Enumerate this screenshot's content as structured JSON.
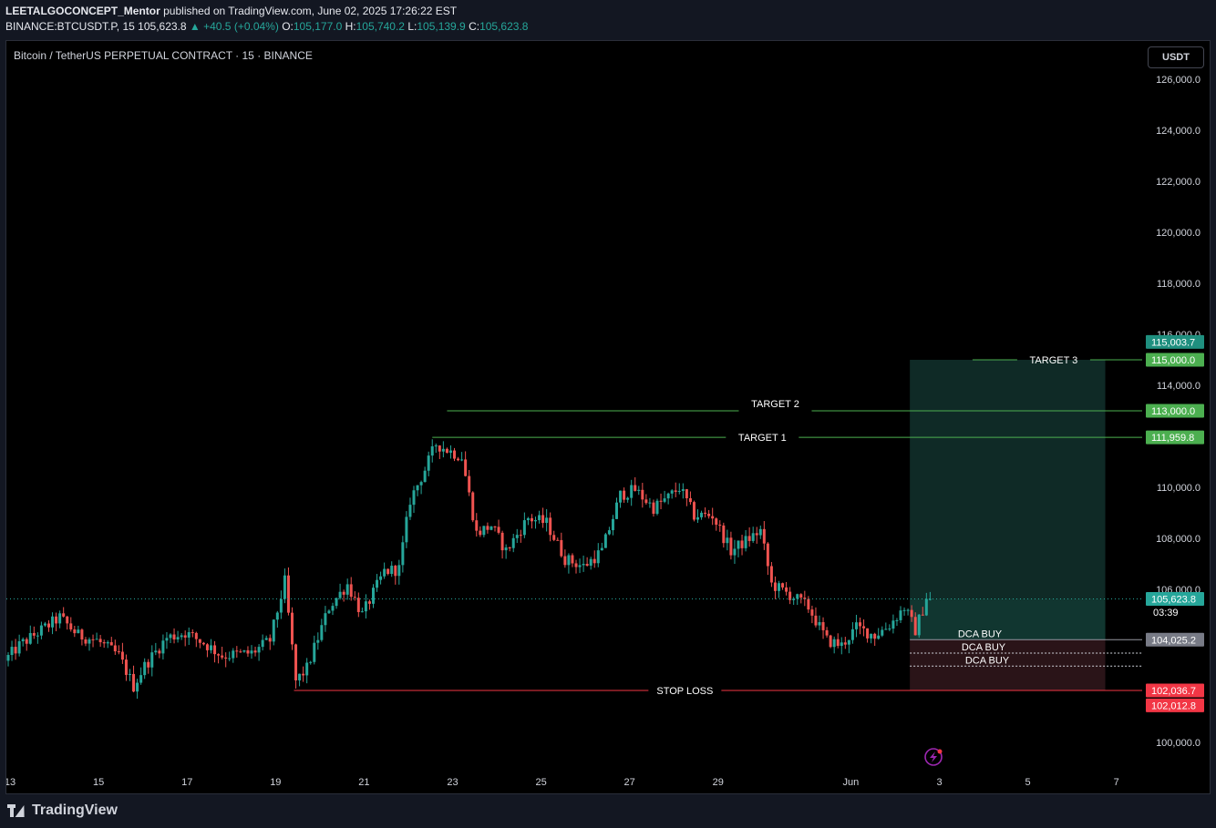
{
  "header": {
    "publisher": "LEETALGOCONCEPT_Mentor",
    "published_text": "published on TradingView.com, June 02, 2025 17:26:22 EST",
    "symbol": "BINANCE:BTCUSDT.P, 15",
    "price": "105,623.8",
    "change": "▲ +40.5 (+0.04%)",
    "o_label": "O:",
    "o_value": "105,177.0",
    "h_label": "H:",
    "h_value": "105,740.2",
    "l_label": "L:",
    "l_value": "105,139.9",
    "c_label": "C:",
    "c_value": "105,623.8"
  },
  "chart_title": "Bitcoin / TetherUS PERPETUAL CONTRACT · 15 · BINANCE",
  "currency_button": "USDT",
  "footer": {
    "brand": "TradingView"
  },
  "colors": {
    "up": "#26a69a",
    "down": "#ef5350",
    "target": "#4caf50",
    "stop": "#f23645",
    "profit_zone": "#0f2a26",
    "loss_zone": "#2a1418",
    "neutral_label": "#787b86"
  },
  "chart_data": {
    "type": "candlestick",
    "y_range": [
      99000,
      127500
    ],
    "y_ticks": [
      100000,
      106000,
      108000,
      110000,
      114000,
      116000,
      118000,
      120000,
      122000,
      124000,
      126000
    ],
    "y_tick_labels": [
      "100,000.0",
      "106,000.0",
      "108,000.0",
      "110,000.0",
      "114,000.0",
      "116,000.0",
      "118,000.0",
      "120,000.0",
      "122,000.0",
      "124,000.0",
      "126,000.0"
    ],
    "x_range": [
      "2025-05-12T22:00",
      "2025-06-07T14:00"
    ],
    "x_ticks": [
      {
        "label": "13",
        "date": "2025-05-13"
      },
      {
        "label": "15",
        "date": "2025-05-15"
      },
      {
        "label": "17",
        "date": "2025-05-17"
      },
      {
        "label": "19",
        "date": "2025-05-19"
      },
      {
        "label": "21",
        "date": "2025-05-21"
      },
      {
        "label": "23",
        "date": "2025-05-23"
      },
      {
        "label": "25",
        "date": "2025-05-25"
      },
      {
        "label": "27",
        "date": "2025-05-27"
      },
      {
        "label": "29",
        "date": "2025-05-29"
      },
      {
        "label": "Jun",
        "date": "2025-06-01"
      },
      {
        "label": "3",
        "date": "2025-06-03"
      },
      {
        "label": "5",
        "date": "2025-06-05"
      },
      {
        "label": "7",
        "date": "2025-06-07"
      }
    ],
    "price_path": [
      [
        "2025-05-12T22:00",
        103200
      ],
      [
        "2025-05-13T06:00",
        103800
      ],
      [
        "2025-05-13T18:00",
        104400
      ],
      [
        "2025-05-14T04:00",
        104900
      ],
      [
        "2025-05-14T14:00",
        104200
      ],
      [
        "2025-05-15T00:00",
        104000
      ],
      [
        "2025-05-15T12:00",
        103400
      ],
      [
        "2025-05-15T20:00",
        102200
      ],
      [
        "2025-05-16T02:00",
        103000
      ],
      [
        "2025-05-16T14:00",
        104100
      ],
      [
        "2025-05-17T00:00",
        104300
      ],
      [
        "2025-05-17T10:00",
        103900
      ],
      [
        "2025-05-17T20:00",
        103400
      ],
      [
        "2025-05-18T12:00",
        103500
      ],
      [
        "2025-05-18T22:00",
        104000
      ],
      [
        "2025-05-19T06:00",
        106300
      ],
      [
        "2025-05-19T12:00",
        102400
      ],
      [
        "2025-05-19T18:00",
        102900
      ],
      [
        "2025-05-20T06:00",
        105300
      ],
      [
        "2025-05-20T16:00",
        106200
      ],
      [
        "2025-05-21T00:00",
        105000
      ],
      [
        "2025-05-21T12:00",
        106700
      ],
      [
        "2025-05-21T20:00",
        106800
      ],
      [
        "2025-05-22T02:00",
        109500
      ],
      [
        "2025-05-22T10:00",
        110700
      ],
      [
        "2025-05-22T16:00",
        111700
      ],
      [
        "2025-05-23T00:00",
        111400
      ],
      [
        "2025-05-23T06:00",
        111200
      ],
      [
        "2025-05-23T14:00",
        108200
      ],
      [
        "2025-05-23T22:00",
        108500
      ],
      [
        "2025-05-24T06:00",
        107500
      ],
      [
        "2025-05-24T18:00",
        108800
      ],
      [
        "2025-05-25T04:00",
        108600
      ],
      [
        "2025-05-25T14:00",
        107200
      ],
      [
        "2025-05-26T00:00",
        106900
      ],
      [
        "2025-05-26T10:00",
        107500
      ],
      [
        "2025-05-26T20:00",
        109700
      ],
      [
        "2025-05-27T04:00",
        109900
      ],
      [
        "2025-05-27T14:00",
        109200
      ],
      [
        "2025-05-27T22:00",
        109600
      ],
      [
        "2025-05-28T04:00",
        110000
      ],
      [
        "2025-05-28T12:00",
        108900
      ],
      [
        "2025-05-28T22:00",
        108900
      ],
      [
        "2025-05-29T08:00",
        107500
      ],
      [
        "2025-05-29T16:00",
        107900
      ],
      [
        "2025-05-30T00:00",
        108300
      ],
      [
        "2025-05-30T06:00",
        106200
      ],
      [
        "2025-05-30T18:00",
        105700
      ],
      [
        "2025-05-31T02:00",
        105300
      ],
      [
        "2025-05-31T12:00",
        104000
      ],
      [
        "2025-05-31T20:00",
        103800
      ],
      [
        "2025-06-01T04:00",
        104500
      ],
      [
        "2025-06-01T14:00",
        104200
      ],
      [
        "2025-06-01T22:00",
        104600
      ],
      [
        "2025-06-02T06:00",
        105300
      ],
      [
        "2025-06-02T12:00",
        104400
      ],
      [
        "2025-06-02T18:00",
        105600
      ]
    ],
    "levels": [
      {
        "name": "TARGET 3",
        "label": "TARGET 3",
        "price": 115000,
        "axis_label": "115,000.0"
      },
      {
        "name": "TARGET 2",
        "label": "TARGET 2",
        "price": 113000,
        "axis_label": "113,000.0"
      },
      {
        "name": "TARGET 1",
        "label": "TARGET 1",
        "price": 111959.8,
        "axis_label": "111,959.8"
      },
      {
        "name": "STOP LOSS",
        "label": "STOP LOSS",
        "price": 102036.7,
        "axis_label": "102,036.7"
      }
    ],
    "dca_levels": [
      {
        "label": "DCA BUY",
        "price": 104025.2
      },
      {
        "label": "DCA BUY",
        "price": 103500
      },
      {
        "label": "DCA BUY",
        "price": 102990
      }
    ],
    "position": {
      "start": "2025-06-02T08:00",
      "end": "2025-06-06T18:00",
      "entry": 104025.2,
      "target": 115000,
      "stop": 102036.7
    },
    "axis_labels": [
      {
        "text": "115,003.7",
        "price": 115700,
        "kind": "profit"
      },
      {
        "text": "115,000.0",
        "price": 115000,
        "kind": "target"
      },
      {
        "text": "113,000.0",
        "price": 113000,
        "kind": "target"
      },
      {
        "text": "111,959.8",
        "price": 111959.8,
        "kind": "target"
      },
      {
        "text": "105,623.8",
        "price": 105623.8,
        "kind": "last"
      },
      {
        "text": "03:39",
        "price": 105100,
        "kind": "countdown"
      },
      {
        "text": "104,025.2",
        "price": 104025.2,
        "kind": "entry"
      },
      {
        "text": "102,036.7",
        "price": 102036.7,
        "kind": "stop"
      },
      {
        "text": "102,012.8",
        "price": 101450,
        "kind": "stop"
      }
    ],
    "last_price": 105623.8
  }
}
